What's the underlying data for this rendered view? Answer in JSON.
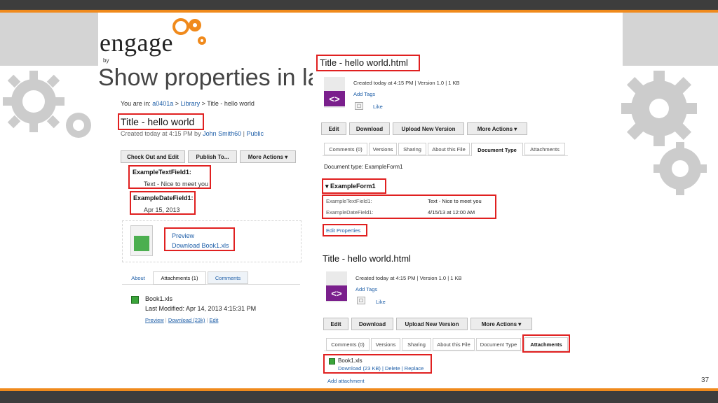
{
  "slide": {
    "title": "Show properties in latest version",
    "page_number": "37",
    "logo_text": "engage",
    "logo_by": "by"
  },
  "left": {
    "breadcrumb_prefix": "You are in:",
    "breadcrumb_link1": "a0401a",
    "breadcrumb_sep1": ">",
    "breadcrumb_link2": "Library",
    "breadcrumb_sep2": ">",
    "breadcrumb_current": "Title - hello world",
    "doc_title": "Title - hello world",
    "created_prefix": "Created today at 4:15 PM by",
    "created_user": "John Smith60",
    "created_sep": "|",
    "visibility": "Public",
    "buttons": [
      "Check Out and Edit",
      "Publish To...",
      "More Actions ▾"
    ],
    "field1_label": "ExampleTextField1:",
    "field1_value": "Text - Nice to meet you",
    "field2_label": "ExampleDateField1:",
    "field2_value": "Apr 15, 2013",
    "preview_link": "Preview",
    "download_link": "Download Book1.xls",
    "tabs": [
      "About",
      "Attachments (1)",
      "Comments"
    ],
    "attachment_name": "Book1.xls",
    "attachment_modified": "Last Modified: Apr 14, 2013 4:15:31 PM",
    "attachment_links": [
      "Preview",
      "Download (23k)",
      "Edit"
    ]
  },
  "right_top": {
    "doc_title": "Title - hello world.html",
    "meta": "Created today at 4:15 PM  |  Version 1.0  |  1 KB",
    "add_tags": "Add Tags",
    "like": "Like",
    "buttons": [
      "Edit",
      "Download",
      "Upload New Version",
      "More Actions ▾"
    ],
    "tabs": [
      "Comments (0)",
      "Versions",
      "Sharing",
      "About this File",
      "Document Type",
      "Attachments"
    ],
    "doc_type_line": "Document type: ExampleForm1",
    "form_name": "▾ ExampleForm1",
    "prop1_label": "ExampleTextField1:",
    "prop1_value": "Text - Nice to meet you",
    "prop2_label": "ExampleDateField1:",
    "prop2_value": "4/15/13 at 12:00 AM",
    "edit_properties": "Edit Properties"
  },
  "right_bottom": {
    "doc_title": "Title - hello world.html",
    "meta": "Created today at 4:15 PM  |  Version 1.0  |  1 KB",
    "add_tags": "Add Tags",
    "like": "Like",
    "buttons": [
      "Edit",
      "Download",
      "Upload New Version",
      "More Actions ▾"
    ],
    "tabs": [
      "Comments (0)",
      "Versions",
      "Sharing",
      "About this File",
      "Document Type",
      "Attachments"
    ],
    "attachment_name": "Book1.xls",
    "attachment_actions": "Download (23 KB) | Delete | Replace",
    "add_attachment": "Add attachment"
  },
  "colors": {
    "accent_orange": "#f08a1c",
    "bar_dark": "#3d3d3d",
    "highlight_red": "#e02020",
    "link_blue": "#1f5fa8",
    "html_icon_purple": "#7a1f8c"
  }
}
